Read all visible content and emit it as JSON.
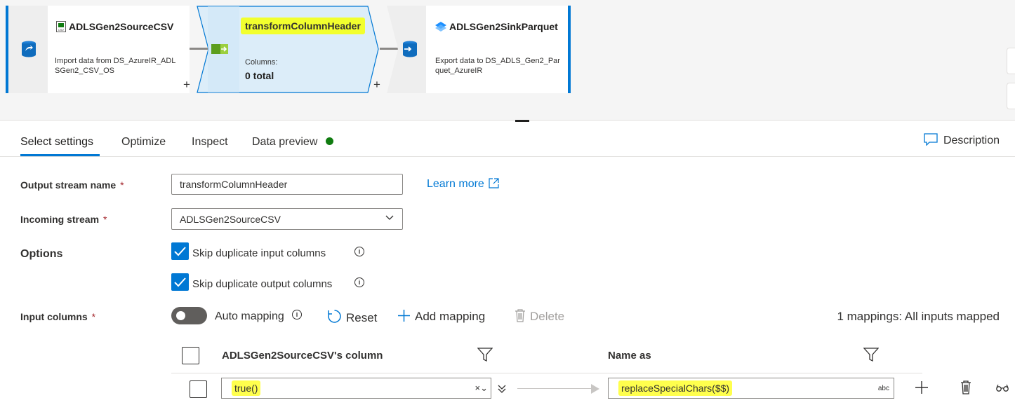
{
  "pipeline": {
    "source": {
      "title": "ADLSGen2SourceCSV",
      "description": "Import data from DS_AzureIR_ADLSGen2_CSV_OS"
    },
    "transform": {
      "title": "transformColumnHeader",
      "columns_label": "Columns:",
      "columns_value": "0 total"
    },
    "sink": {
      "title": "ADLSGen2SinkParquet",
      "description": "Export data to DS_ADLS_Gen2_Parquet_AzureIR"
    },
    "plus_symbol": "+"
  },
  "tabs": [
    {
      "label": "Select settings",
      "active": true
    },
    {
      "label": "Optimize"
    },
    {
      "label": "Inspect"
    },
    {
      "label": "Data preview"
    }
  ],
  "description_button": "Description",
  "form": {
    "output_stream": {
      "label": "Output stream name",
      "required": "*",
      "value": "transformColumnHeader"
    },
    "learn_more": "Learn more",
    "incoming_stream": {
      "label": "Incoming stream",
      "required": "*",
      "value": "ADLSGen2SourceCSV"
    },
    "options": {
      "label": "Options",
      "skip_input": {
        "label": "Skip duplicate input columns",
        "checked": true
      },
      "skip_output": {
        "label": "Skip duplicate output columns",
        "checked": true
      }
    },
    "input_columns": {
      "label": "Input columns",
      "required": "*"
    },
    "auto_mapping": {
      "label": "Auto mapping",
      "enabled": false
    },
    "reset": "Reset",
    "add_mapping": "Add mapping",
    "delete": "Delete",
    "mappings_count": "1 mappings: All inputs mapped"
  },
  "grid": {
    "col_source": "ADLSGen2SourceCSV's column",
    "col_target": "Name as",
    "rows": [
      {
        "source": "true()",
        "target": "replaceSpecialChars($$)",
        "type": "abc"
      }
    ]
  },
  "colors": {
    "accent": "#0078d4",
    "highlight": "#ffff4d",
    "status_ok": "#107c10"
  }
}
